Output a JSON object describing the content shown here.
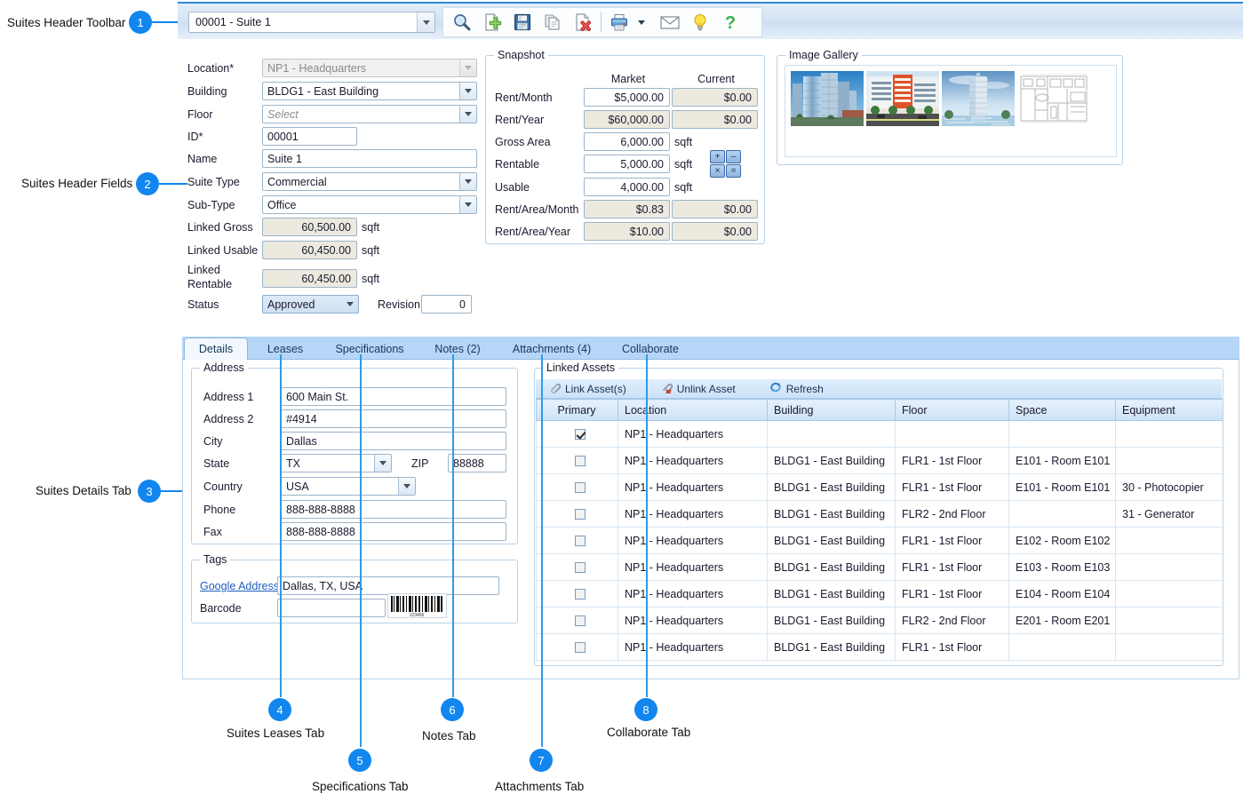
{
  "callouts": [
    {
      "n": "1",
      "label": "Suites Header Toolbar"
    },
    {
      "n": "2",
      "label": "Suites Header Fields"
    },
    {
      "n": "3",
      "label": "Suites Details Tab"
    },
    {
      "n": "4",
      "label": "Suites Leases Tab"
    },
    {
      "n": "5",
      "label": "Specifications Tab"
    },
    {
      "n": "6",
      "label": "Notes Tab"
    },
    {
      "n": "7",
      "label": "Attachments Tab"
    },
    {
      "n": "8",
      "label": "Collaborate Tab"
    }
  ],
  "toolbar": {
    "record_selector_value": "00001 - Suite 1",
    "icons": [
      {
        "name": "search-icon",
        "title": "Search"
      },
      {
        "name": "new-record-icon",
        "title": "New"
      },
      {
        "name": "save-icon",
        "title": "Save"
      },
      {
        "name": "copy-icon",
        "title": "Copy"
      },
      {
        "name": "delete-icon",
        "title": "Delete"
      },
      {
        "name": "print-icon",
        "title": "Print"
      },
      {
        "name": "email-icon",
        "title": "Email"
      },
      {
        "name": "tips-icon",
        "title": "Tips"
      },
      {
        "name": "help-icon",
        "title": "Help"
      }
    ]
  },
  "header_fields": {
    "location": {
      "label": "Location*",
      "value": "NP1 - Headquarters"
    },
    "building": {
      "label": "Building",
      "value": "BLDG1 - East Building"
    },
    "floor": {
      "label": "Floor",
      "placeholder": "Select"
    },
    "id": {
      "label": "ID*",
      "value": "00001"
    },
    "name": {
      "label": "Name",
      "value": "Suite 1"
    },
    "suite_type": {
      "label": "Suite Type",
      "value": "Commercial"
    },
    "sub_type": {
      "label": "Sub-Type",
      "value": "Office"
    },
    "linked_gross": {
      "label": "Linked Gross",
      "value": "60,500.00",
      "unit": "sqft"
    },
    "linked_usable": {
      "label": "Linked Usable",
      "value": "60,450.00",
      "unit": "sqft"
    },
    "linked_rentable": {
      "label": "Linked\nRentable",
      "label_line1": "Linked",
      "label_line2": "Rentable",
      "value": "60,450.00",
      "unit": "sqft"
    },
    "status": {
      "label": "Status",
      "value": "Approved"
    },
    "revision": {
      "label": "Revision",
      "value": "0"
    }
  },
  "snapshot": {
    "title": "Snapshot",
    "col_market": "Market",
    "col_current": "Current",
    "rows": [
      {
        "label": "Rent/Month",
        "market": "$5,000.00",
        "current": "$0.00",
        "unit": "",
        "market_readonly": false,
        "current_readonly": true
      },
      {
        "label": "Rent/Year",
        "market": "$60,000.00",
        "current": "$0.00",
        "unit": "",
        "market_readonly": true,
        "current_readonly": true
      },
      {
        "label": "Gross Area",
        "market": "6,000.00",
        "current": "",
        "unit": "sqft",
        "market_readonly": false,
        "current_readonly": false
      },
      {
        "label": "Rentable",
        "market": "5,000.00",
        "current": "",
        "unit": "sqft",
        "market_readonly": false,
        "current_readonly": false
      },
      {
        "label": "Usable",
        "market": "4,000.00",
        "current": "",
        "unit": "sqft",
        "market_readonly": false,
        "current_readonly": false
      },
      {
        "label": "Rent/Area/Month",
        "market": "$0.83",
        "current": "$0.00",
        "unit": "",
        "market_readonly": true,
        "current_readonly": true
      },
      {
        "label": "Rent/Area/Year",
        "market": "$10.00",
        "current": "$0.00",
        "unit": "",
        "market_readonly": true,
        "current_readonly": true
      }
    ],
    "calc_buttons": [
      "+",
      "–",
      "×",
      "="
    ]
  },
  "image_gallery": {
    "title": "Image Gallery",
    "thumbnails": [
      {
        "name": "glass-tower-photo"
      },
      {
        "name": "midrise-street-photo"
      },
      {
        "name": "waterfront-tower-photo"
      },
      {
        "name": "floorplan-drawing"
      }
    ]
  },
  "tabs": [
    {
      "label": "Details",
      "active": true
    },
    {
      "label": "Leases",
      "active": false
    },
    {
      "label": "Specifications",
      "active": false
    },
    {
      "label": "Notes (2)",
      "active": false
    },
    {
      "label": "Attachments (4)",
      "active": false
    },
    {
      "label": "Collaborate",
      "active": false
    }
  ],
  "address": {
    "title": "Address",
    "fields": [
      {
        "label": "Address 1",
        "value": "600 Main St."
      },
      {
        "label": "Address 2",
        "value": "#4914"
      },
      {
        "label": "City",
        "value": "Dallas"
      },
      {
        "label": "State",
        "value": "TX"
      },
      {
        "label": "Country",
        "value": "USA"
      },
      {
        "label": "Phone",
        "value": "888-888-8888"
      },
      {
        "label": "Fax",
        "value": "888-888-8888"
      }
    ],
    "zip": {
      "label": "ZIP",
      "value": "88888"
    }
  },
  "tags": {
    "title": "Tags",
    "google_address": {
      "label": "Google Address",
      "value": "Dallas, TX, USA"
    },
    "barcode": {
      "label": "Barcode",
      "value": "",
      "caption": "123456"
    }
  },
  "linked_assets": {
    "title": "Linked Assets",
    "toolbar": [
      {
        "label": "Link Asset(s)",
        "icon": "link-asset-icon"
      },
      {
        "label": "Unlink Asset",
        "icon": "unlink-asset-icon"
      },
      {
        "label": "Refresh",
        "icon": "refresh-icon"
      }
    ],
    "columns": [
      "Primary",
      "Location",
      "Building",
      "Floor",
      "Space",
      "Equipment"
    ],
    "rows": [
      {
        "primary": true,
        "location": "NP1 - Headquarters",
        "building": "",
        "floor": "",
        "space": "",
        "equipment": ""
      },
      {
        "primary": false,
        "location": "NP1 - Headquarters",
        "building": "BLDG1 - East Building",
        "floor": "FLR1 - 1st Floor",
        "space": "E101 - Room E101",
        "equipment": ""
      },
      {
        "primary": false,
        "location": "NP1 - Headquarters",
        "building": "BLDG1 - East Building",
        "floor": "FLR1 - 1st Floor",
        "space": "E101 - Room E101",
        "equipment": "30 - Photocopier"
      },
      {
        "primary": false,
        "location": "NP1 - Headquarters",
        "building": "BLDG1 - East Building",
        "floor": "FLR2 - 2nd Floor",
        "space": "",
        "equipment": "31 - Generator"
      },
      {
        "primary": false,
        "location": "NP1 - Headquarters",
        "building": "BLDG1 - East Building",
        "floor": "FLR1 - 1st Floor",
        "space": "E102 - Room E102",
        "equipment": ""
      },
      {
        "primary": false,
        "location": "NP1 - Headquarters",
        "building": "BLDG1 - East Building",
        "floor": "FLR1 - 1st Floor",
        "space": "E103 - Room E103",
        "equipment": ""
      },
      {
        "primary": false,
        "location": "NP1 - Headquarters",
        "building": "BLDG1 - East Building",
        "floor": "FLR1 - 1st Floor",
        "space": "E104 - Room E104",
        "equipment": ""
      },
      {
        "primary": false,
        "location": "NP1 - Headquarters",
        "building": "BLDG1 - East Building",
        "floor": "FLR2 - 2nd Floor",
        "space": "E201 - Room E201",
        "equipment": ""
      },
      {
        "primary": false,
        "location": "NP1 - Headquarters",
        "building": "BLDG1 - East Building",
        "floor": "FLR1 - 1st Floor",
        "space": "",
        "equipment": ""
      }
    ]
  },
  "colors": {
    "accent": "#1186ee",
    "toolbar_border": "#2b8ad8",
    "tab_strip": "#b6d6f7",
    "group_border": "#b9d2e8",
    "readonly_field": "#eceadf",
    "link": "#1f5fbf"
  }
}
